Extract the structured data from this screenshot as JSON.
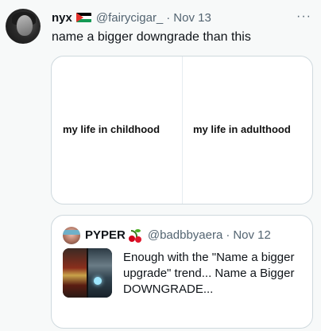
{
  "tweet": {
    "author_name": "nyx",
    "handle": "@fairycigar_",
    "separator": "·",
    "date": "Nov 13",
    "more_icon": "···",
    "text": "name a bigger downgrade than this",
    "media": {
      "left_caption": "my life in childhood",
      "right_caption": "my life in adulthood"
    }
  },
  "quoted_tweet": {
    "author_name": "PYPER",
    "handle": "@badbbyaera",
    "separator": "·",
    "date": "Nov 12",
    "text": "Enough with the \"Name a bigger upgrade\" trend... Name a Bigger DOWNGRADE..."
  },
  "colors": {
    "background": "#f7f9f9",
    "text_primary": "#0f1419",
    "text_muted": "#536471",
    "border": "#cfd9de"
  },
  "icons": [
    "palestine-flag-icon",
    "cherry-emoji-icon",
    "more-options-icon"
  ]
}
